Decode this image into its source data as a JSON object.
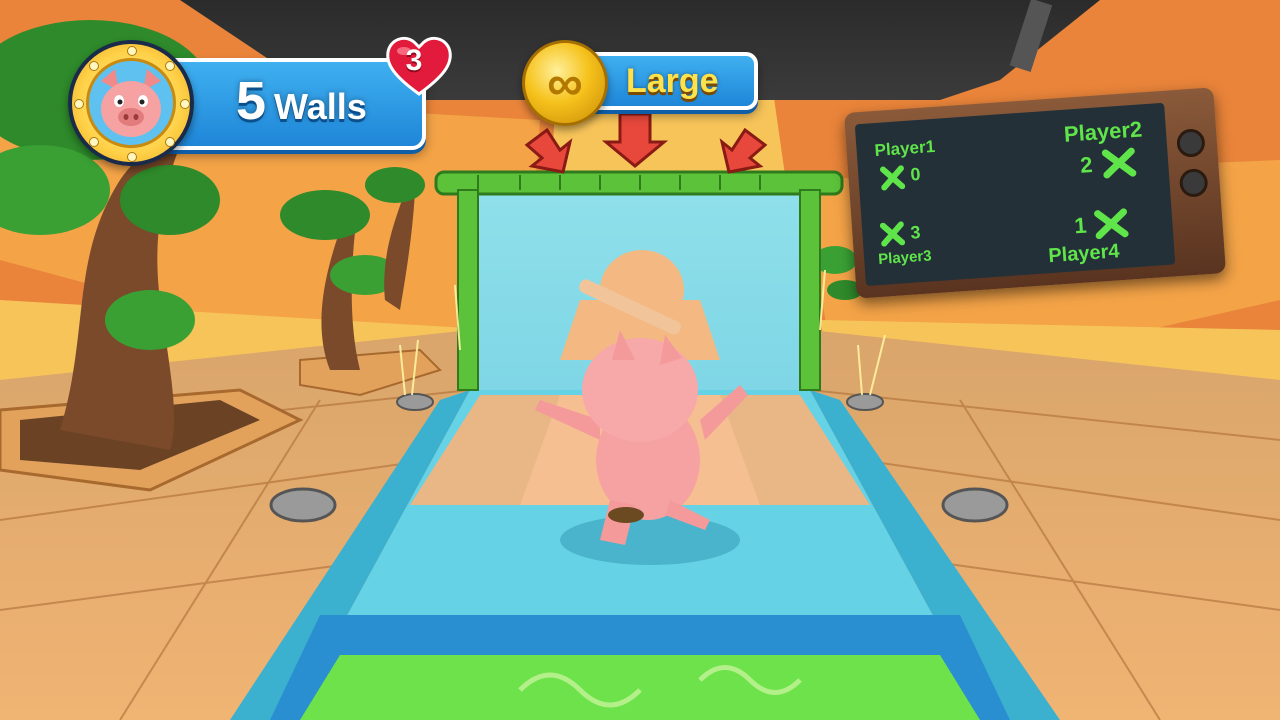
{
  "hud": {
    "walls_count": "5",
    "walls_label": "Walls",
    "lives": "3",
    "size_label": "Large",
    "coin_icon": "infinity-coin-icon"
  },
  "scoreboard": {
    "players": [
      {
        "name": "Player1",
        "score": "0"
      },
      {
        "name": "Player2",
        "score": "2"
      },
      {
        "name": "Player3",
        "score": "3"
      },
      {
        "name": "Player4",
        "score": "1"
      }
    ]
  },
  "colors": {
    "hud_blue": "#2a9ae6",
    "score_green": "#5fe44a",
    "heart_red": "#e21b3c",
    "coin_gold": "#f6c21c"
  }
}
